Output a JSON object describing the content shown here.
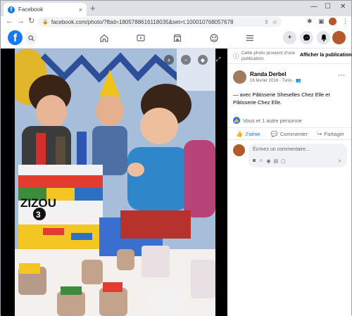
{
  "browser": {
    "tab_title": "Facebook",
    "tab_close": "×",
    "new_tab": "+",
    "url": "facebook.com/photo/?fbid=1805788616118035&set=t.100010768057678",
    "win_min": "—",
    "win_max": "☐",
    "win_close": "✕"
  },
  "fb_header": {
    "logo": "f"
  },
  "viewer": {
    "colors": {
      "background": "#000000"
    }
  },
  "side": {
    "notice_text": "Cette photo provient d'une publication.",
    "notice_link": "Afficher la publication",
    "author": "Randa Derbel",
    "date": "16 février 2018 · Tunis ·",
    "caption": "— avec Pâtisserie Sheselles Chez Elle et Pâtisserie Chez Elle.",
    "reactions": "Vous et 1 autre personne",
    "actions": {
      "like": "J'aime",
      "comment": "Commenter",
      "share": "Partager"
    },
    "comment_placeholder": "Écrivez un commentaire…"
  },
  "colors": {
    "brand": "#1877f2",
    "secondary_text": "#65676b"
  }
}
